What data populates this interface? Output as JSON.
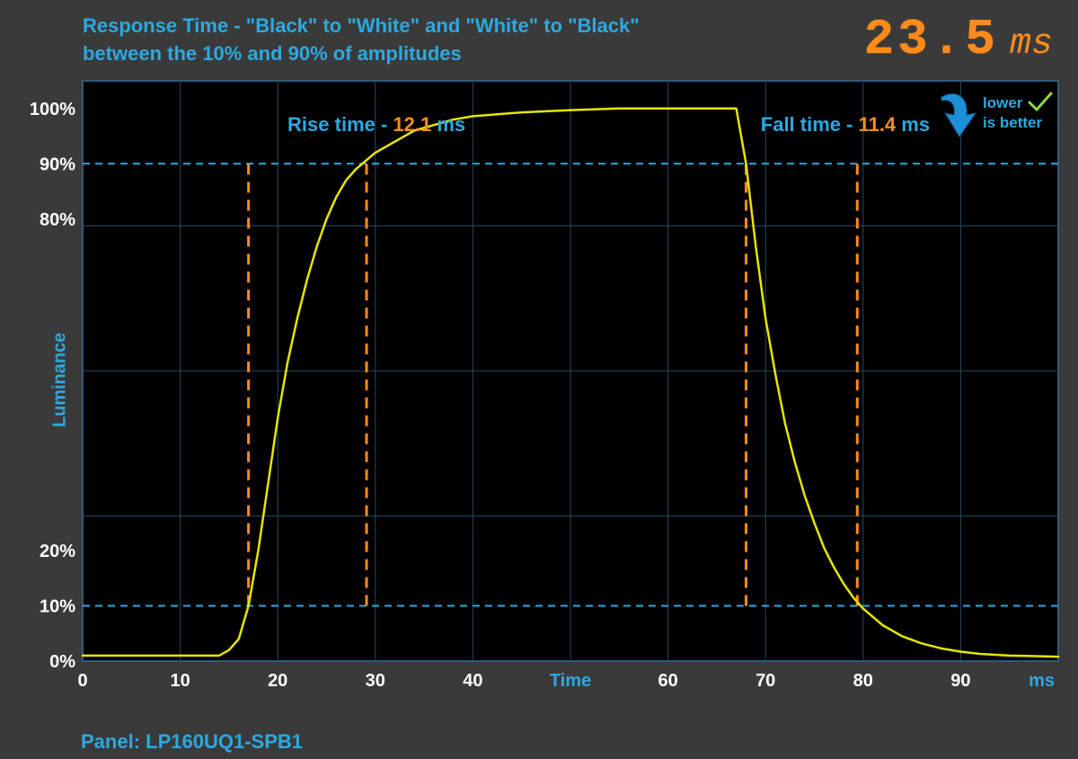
{
  "header": {
    "title_line1": "Response Time - \"Black\" to \"White\" and \"White\" to \"Black\"",
    "title_line2": "between the 10% and 90% of amplitudes"
  },
  "readout": {
    "value": "23.5",
    "unit": "ms"
  },
  "panel": {
    "label_prefix": "Panel: ",
    "model": "LP160UQ1-SPB1"
  },
  "badge": {
    "line1": "lower",
    "line2": "is better"
  },
  "axes": {
    "ylabel": "Luminance",
    "xlabel": "Time",
    "x_unit": "ms",
    "x_ticks": [
      "0",
      "10",
      "20",
      "30",
      "40",
      "",
      "60",
      "70",
      "80",
      "90",
      ""
    ],
    "y_ticks_pct": [
      0,
      10,
      20,
      80,
      90,
      100
    ],
    "xlim": [
      0,
      100
    ],
    "ylim": [
      0,
      105
    ]
  },
  "annotations": {
    "rise_label": "Rise time - ",
    "rise_value": "12.1",
    "rise_unit": "  ms",
    "fall_label": "Fall time - ",
    "fall_value": "11.4",
    "fall_unit": "  ms"
  },
  "markers": {
    "rise_start_x": 17.0,
    "rise_end_x": 29.1,
    "fall_start_x": 68.0,
    "fall_end_x": 79.4,
    "threshold_low": 10,
    "threshold_high": 90
  },
  "chart_data": {
    "type": "line",
    "title": "Response Time - \"Black\" to \"White\" and \"White\" to \"Black\" between the 10% and 90% of amplitudes",
    "xlabel": "Time",
    "ylabel": "Luminance",
    "x_unit": "ms",
    "y_unit": "%",
    "xlim": [
      0,
      100
    ],
    "ylim": [
      0,
      105
    ],
    "thresholds": [
      10,
      90
    ],
    "rise_time_ms": 12.1,
    "fall_time_ms": 11.4,
    "total_ms": 23.5,
    "panel": "LP160UQ1-SPB1",
    "series": [
      {
        "name": "Luminance",
        "x": [
          0,
          5,
          10,
          14,
          15,
          16,
          17,
          18,
          19,
          20,
          21,
          22,
          23,
          24,
          25,
          26,
          27,
          28,
          29,
          30,
          32,
          34,
          36,
          38,
          40,
          45,
          50,
          55,
          60,
          63,
          65,
          66,
          67,
          68,
          69,
          70,
          71,
          72,
          73,
          74,
          75,
          76,
          77,
          78,
          79,
          80,
          82,
          84,
          86,
          88,
          90,
          92,
          95,
          100
        ],
        "y": [
          1,
          1,
          1,
          1,
          2,
          4,
          10,
          20,
          32,
          44,
          54,
          62,
          69,
          75,
          80,
          84,
          87,
          89,
          90.5,
          92,
          94,
          96,
          97,
          98,
          98.6,
          99.3,
          99.7,
          100,
          100,
          100,
          100,
          100,
          100,
          90,
          75,
          62,
          52,
          43,
          36,
          30,
          25,
          20.5,
          17,
          14,
          11.5,
          9.5,
          6.5,
          4.5,
          3.2,
          2.3,
          1.7,
          1.3,
          1.0,
          0.8
        ]
      }
    ]
  }
}
